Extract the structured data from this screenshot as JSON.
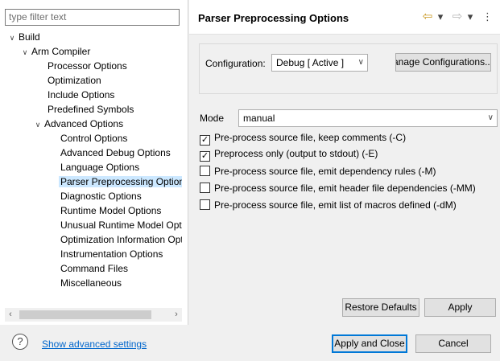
{
  "filter": {
    "placeholder": "type filter text"
  },
  "tree": {
    "items": [
      {
        "label": "Build",
        "toggle": "∨"
      },
      {
        "label": "Arm Compiler",
        "toggle": "∨"
      },
      {
        "label": "Processor Options",
        "toggle": ""
      },
      {
        "label": "Optimization",
        "toggle": ""
      },
      {
        "label": "Include Options",
        "toggle": ""
      },
      {
        "label": "Predefined Symbols",
        "toggle": ""
      },
      {
        "label": "Advanced Options",
        "toggle": "∨"
      },
      {
        "label": "Control Options",
        "toggle": ""
      },
      {
        "label": "Advanced Debug Options",
        "toggle": ""
      },
      {
        "label": "Language Options",
        "toggle": ""
      },
      {
        "label": "Parser Preprocessing Options",
        "toggle": ""
      },
      {
        "label": "Diagnostic Options",
        "toggle": ""
      },
      {
        "label": "Runtime Model Options",
        "toggle": ""
      },
      {
        "label": "Unusual Runtime Model Options",
        "toggle": ""
      },
      {
        "label": "Optimization Information Options",
        "toggle": ""
      },
      {
        "label": "Instrumentation Options",
        "toggle": ""
      },
      {
        "label": "Command Files",
        "toggle": ""
      },
      {
        "label": "Miscellaneous",
        "toggle": ""
      }
    ],
    "scroll_left": "‹",
    "scroll_right": "›"
  },
  "header": {
    "title": "Parser Preprocessing Options",
    "back_icon": "⇦",
    "forward_icon": "⇨",
    "dropdown_icon": "▾",
    "menu_icon": "⋮"
  },
  "configuration": {
    "label": "Configuration:",
    "value": "Debug  [ Active ]",
    "manage_button": "Manage Configurations..."
  },
  "mode": {
    "label": "Mode",
    "value": "manual"
  },
  "options": [
    {
      "label": "Pre-process source file, keep comments (-C)",
      "checked": true
    },
    {
      "label": "Preprocess only (output to stdout) (-E)",
      "checked": true
    },
    {
      "label": "Pre-process source file, emit dependency rules (-M)",
      "checked": false
    },
    {
      "label": "Pre-process source file, emit header file dependencies (-MM)",
      "checked": false
    },
    {
      "label": "Pre-process source file, emit list of macros defined (-dM)",
      "checked": false
    }
  ],
  "buttons": {
    "restore_defaults": "Restore Defaults",
    "apply": "Apply",
    "apply_and_close": "Apply and Close",
    "cancel": "Cancel"
  },
  "footer": {
    "help_icon": "?",
    "advanced_link": "Show advanced settings"
  },
  "colors": {
    "selection": "#cce8ff",
    "accent": "#0078d7",
    "link": "#0066cc"
  }
}
